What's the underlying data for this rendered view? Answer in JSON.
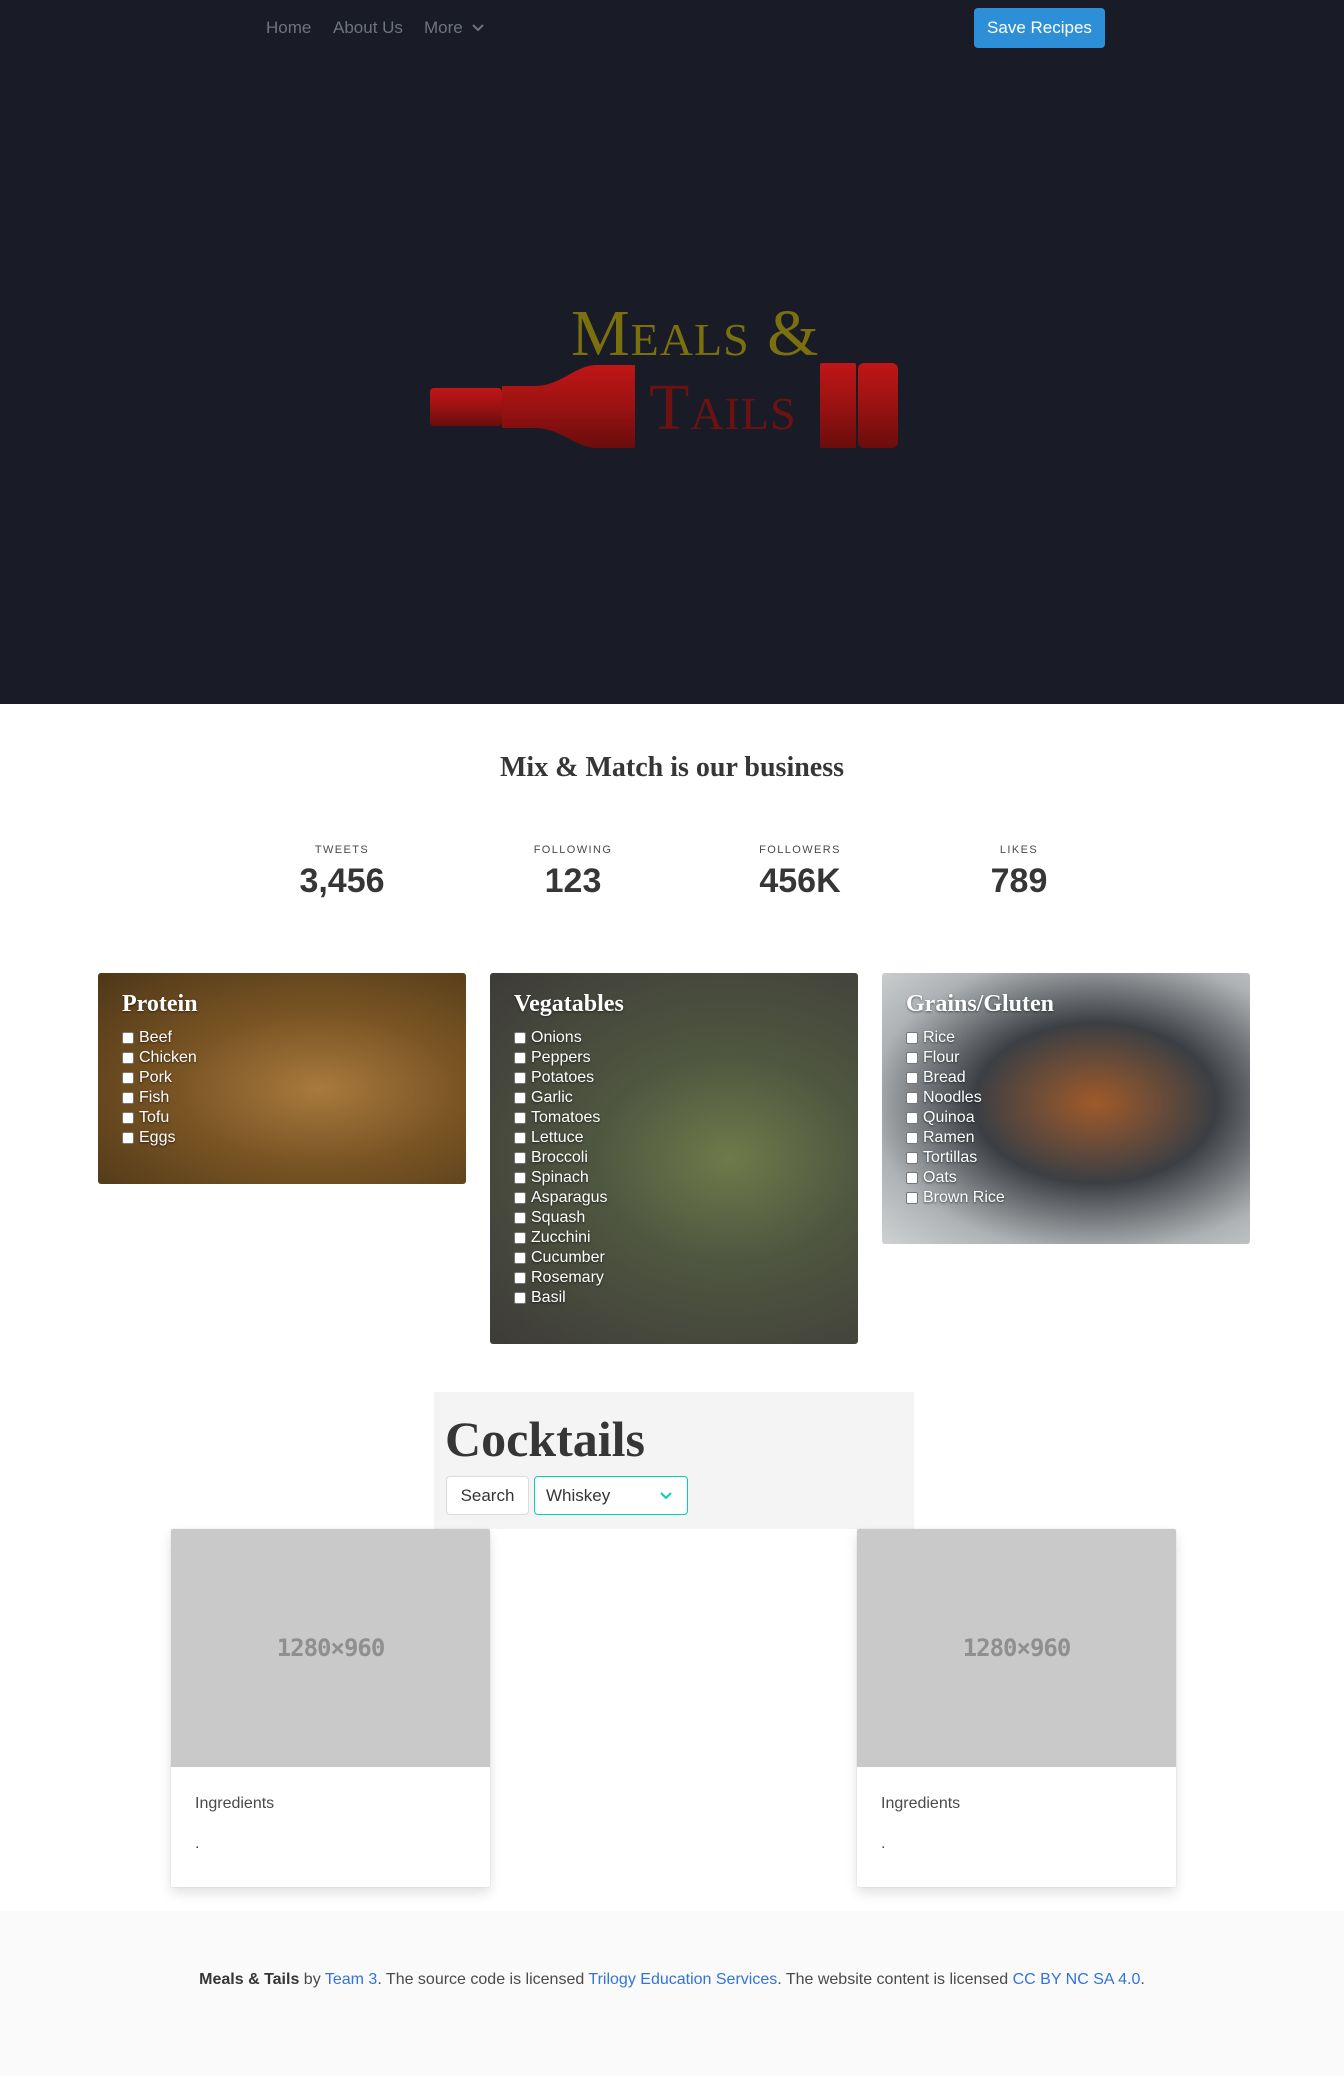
{
  "nav": {
    "home": "Home",
    "about": "About Us",
    "more": "More",
    "save_recipes": "Save Recipes"
  },
  "logo": {
    "line1": "Meals &",
    "line2": "Tails",
    "colors": {
      "gold": "#7b700e",
      "wine": "#a11414",
      "dark_red": "#6d1212"
    }
  },
  "tagline": "Mix & Match is our business",
  "stats": [
    {
      "label": "Tweets",
      "value": "3,456"
    },
    {
      "label": "Following",
      "value": "123"
    },
    {
      "label": "Followers",
      "value": "456K"
    },
    {
      "label": "Likes",
      "value": "789"
    }
  ],
  "categories": [
    {
      "title": "Protein",
      "items": [
        "Beef",
        "Chicken",
        "Pork",
        "Fish",
        "Tofu",
        "Eggs"
      ]
    },
    {
      "title": "Vegatables",
      "items": [
        "Onions",
        "Peppers",
        "Potatoes",
        "Garlic",
        "Tomatoes",
        "Lettuce",
        "Broccoli",
        "Spinach",
        "Asparagus",
        "Squash",
        "Zucchini",
        "Cucumber",
        "Rosemary",
        "Basil"
      ]
    },
    {
      "title": "Grains/Gluten",
      "items": [
        "Rice",
        "Flour",
        "Bread",
        "Noodles",
        "Quinoa",
        "Ramen",
        "Tortillas",
        "Oats",
        "Brown Rice"
      ]
    }
  ],
  "cocktails": {
    "title": "Cocktails",
    "search_label": "Search",
    "selected_spirit": "Whiskey",
    "cards": [
      {
        "placeholder": "1280×960",
        "ingredients_label": "Ingredients",
        "ingredients_value": "."
      },
      {
        "placeholder": "1280×960",
        "ingredients_label": "Ingredients",
        "ingredients_value": "."
      }
    ]
  },
  "footer": {
    "brand": "Meals & Tails",
    "by": " by ",
    "team_link": "Team 3",
    "mid": ". The source code is licensed ",
    "license_link": "Trilogy Education Services",
    "mid2": ". The website content is licensed ",
    "content_link": "CC BY NC SA 4.0",
    "end": "."
  },
  "colors": {
    "hero_bg": "#191c27",
    "primary_button": "#2e8fd9",
    "select_border": "#00d1b2",
    "link": "#3273dc"
  }
}
